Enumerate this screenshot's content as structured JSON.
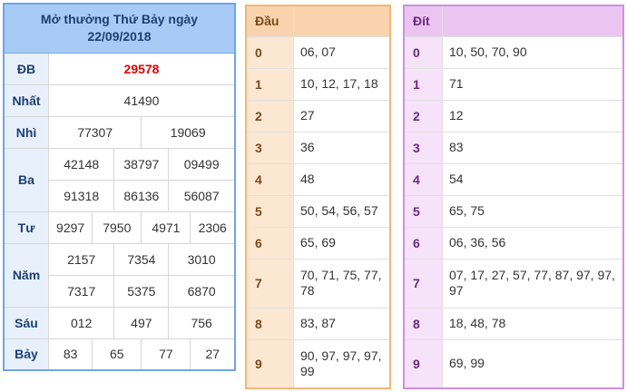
{
  "results": {
    "title_line1": "Mở thưởng Thứ Bảy ngày",
    "title_line2": "22/09/2018",
    "prizes": {
      "db": {
        "label": "ĐB",
        "values": [
          "29578"
        ]
      },
      "nhat": {
        "label": "Nhất",
        "values": [
          "41490"
        ]
      },
      "nhi": {
        "label": "Nhì",
        "values": [
          "77307",
          "19069"
        ]
      },
      "ba": {
        "label": "Ba",
        "values": [
          "42148",
          "38797",
          "09499",
          "91318",
          "86136",
          "56087"
        ]
      },
      "tu": {
        "label": "Tư",
        "values": [
          "9297",
          "7950",
          "4971",
          "2306"
        ]
      },
      "nam": {
        "label": "Năm",
        "values": [
          "2157",
          "7354",
          "3010",
          "7317",
          "5375",
          "6870"
        ]
      },
      "sau": {
        "label": "Sáu",
        "values": [
          "012",
          "497",
          "756"
        ]
      },
      "bay": {
        "label": "Bảy",
        "values": [
          "83",
          "65",
          "77",
          "27"
        ]
      }
    }
  },
  "dau": {
    "header": "Đầu",
    "rows": [
      {
        "key": "0",
        "value": "06, 07"
      },
      {
        "key": "1",
        "value": "10, 12, 17, 18"
      },
      {
        "key": "2",
        "value": "27"
      },
      {
        "key": "3",
        "value": "36"
      },
      {
        "key": "4",
        "value": "48"
      },
      {
        "key": "5",
        "value": "50, 54, 56, 57"
      },
      {
        "key": "6",
        "value": "65, 69"
      },
      {
        "key": "7",
        "value": "70, 71, 75, 77, 78"
      },
      {
        "key": "8",
        "value": "83, 87"
      },
      {
        "key": "9",
        "value": "90, 97, 97, 97, 99"
      }
    ]
  },
  "dit": {
    "header": "Đít",
    "rows": [
      {
        "key": "0",
        "value": "10, 50, 70, 90"
      },
      {
        "key": "1",
        "value": "71"
      },
      {
        "key": "2",
        "value": "12"
      },
      {
        "key": "3",
        "value": "83"
      },
      {
        "key": "4",
        "value": "54"
      },
      {
        "key": "5",
        "value": "65, 75"
      },
      {
        "key": "6",
        "value": "06, 36, 56"
      },
      {
        "key": "7",
        "value": "07, 17, 27, 57, 77, 87, 97, 97, 97"
      },
      {
        "key": "8",
        "value": "18, 48, 78"
      },
      {
        "key": "9",
        "value": "69, 99"
      }
    ]
  },
  "colors": {
    "results_border": "#6da6e6",
    "results_header": "#a8cbf5",
    "special_prize": "#e00000",
    "dau_border": "#f2b77a",
    "dit_border": "#cf8fe0"
  }
}
